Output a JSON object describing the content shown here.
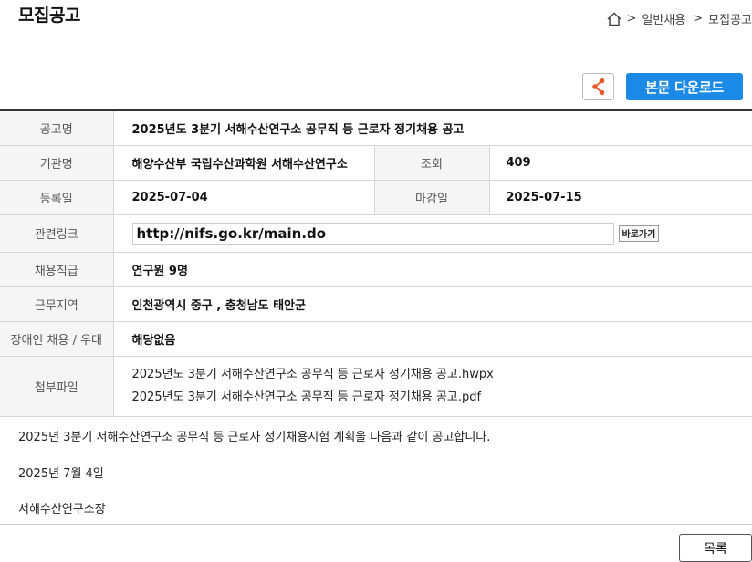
{
  "page": {
    "title": "모집공고"
  },
  "breadcrumb": {
    "items": [
      "일반채용",
      "모집공고"
    ],
    "separator": ">"
  },
  "actions": {
    "download_label": "본문 다운로드",
    "list_label": "목록",
    "share_icon": "share-icon"
  },
  "info": {
    "title_label": "공고명",
    "title_value": "2025년도 3분기 서해수산연구소 공무직 등 근로자 정기채용 공고",
    "org_label": "기관명",
    "org_value": "해양수산부 국립수산과학원 서해수산연구소",
    "views_label": "조회",
    "views_value": "409",
    "reg_label": "등록일",
    "reg_value": "2025-07-04",
    "deadline_label": "마감일",
    "deadline_value": "2025-07-15",
    "link_label": "관련링크",
    "link_value": "http://nifs.go.kr/main.do",
    "go_label": "바로가기",
    "grade_label": "채용직급",
    "grade_value": "연구원 9명",
    "region_label": "근무지역",
    "region_value": "인천광역시 중구 , 충청남도 태안군",
    "disabled_label": "장애인 채용 / 우대",
    "disabled_value": "해당없음",
    "files_label": "첨부파일",
    "files": [
      "2025년도 3분기 서해수산연구소 공무직 등 근로자 정기채용 공고.hwpx",
      "2025년도 3분기 서해수산연구소 공무직 등 근로자 정기채용 공고.pdf"
    ]
  },
  "content": {
    "line1": "2025년 3분기 서해수산연구소 공무직 등 근로자 정기채용시험 계획을 다음과 같이 공고합니다.",
    "line2": "2025년 7월 4일",
    "line3": "서해수산연구소장"
  },
  "colors": {
    "accent": "#1a8ae6",
    "share": "#e8572a"
  }
}
